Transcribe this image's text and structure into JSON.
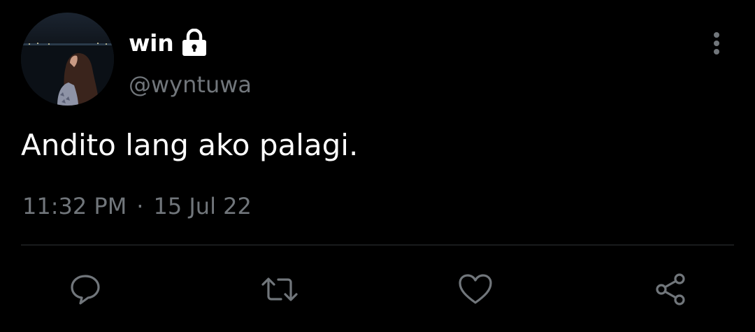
{
  "user": {
    "display_name": "win",
    "handle": "@wyntuwa",
    "protected_icon": "lock-icon",
    "avatar": "avatar-photo"
  },
  "tweet": {
    "text": "Andito lang ako palagi.",
    "time": "11:32 PM",
    "separator": "·",
    "date": "15 Jul 22"
  },
  "menu": {
    "icon": "more-vertical-icon"
  },
  "actions": [
    {
      "name": "reply",
      "icon": "reply-icon"
    },
    {
      "name": "retweet",
      "icon": "retweet-icon"
    },
    {
      "name": "like",
      "icon": "heart-icon"
    },
    {
      "name": "share",
      "icon": "share-icon"
    }
  ],
  "colors": {
    "background": "#000000",
    "primary_text": "#ffffff",
    "secondary_text": "#71767b",
    "divider": "#2f3336",
    "icon": "#71767b"
  }
}
